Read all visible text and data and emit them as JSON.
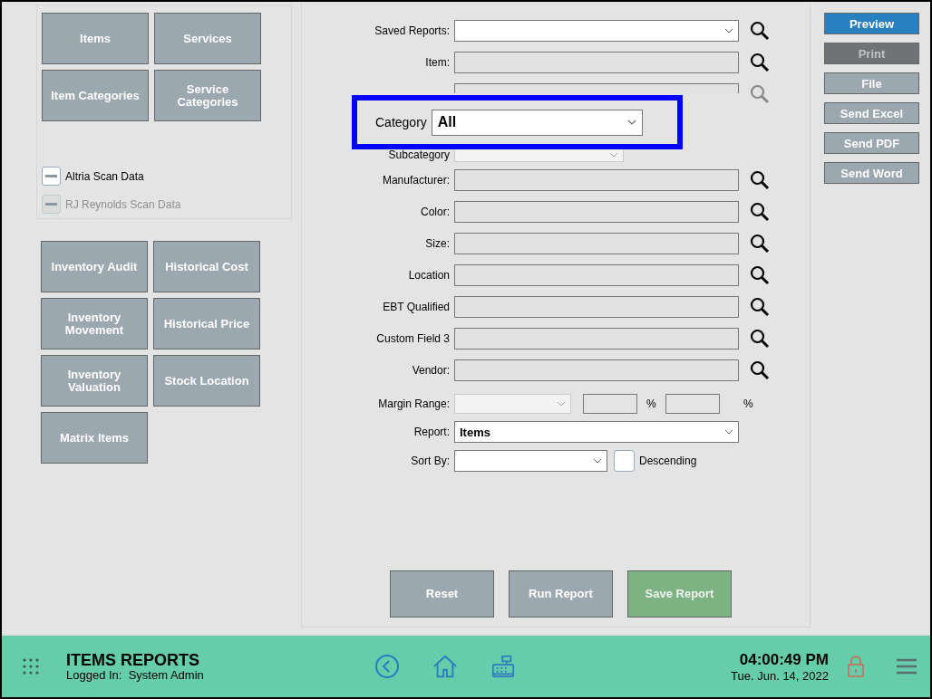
{
  "report_types": {
    "buttons": [
      {
        "label": "Items",
        "disabled": false
      },
      {
        "label": "Services",
        "disabled": false
      },
      {
        "label": "Item Categories",
        "disabled": false
      },
      {
        "label": "Service Categories",
        "disabled": false
      }
    ],
    "checkboxes": [
      {
        "label": "Altria Scan Data",
        "mixed": true,
        "disabled": false
      },
      {
        "label": "RJ Reynolds Scan Data",
        "mixed": true,
        "disabled": true
      }
    ]
  },
  "inventory_buttons": [
    {
      "label": "Inventory Audit"
    },
    {
      "label": "Historical Cost"
    },
    {
      "label": "Inventory Movement"
    },
    {
      "label": "Historical Price"
    },
    {
      "label": "Inventory Valuation"
    },
    {
      "label": "Stock Location"
    },
    {
      "label": "Matrix Items"
    }
  ],
  "form": {
    "rows": [
      {
        "kind": "dropdown",
        "label": "Saved Reports:",
        "value": "",
        "search": {
          "disabled": false
        }
      },
      {
        "kind": "lookup",
        "label": "Item:",
        "value": "",
        "search": {
          "disabled": false
        }
      },
      {
        "kind": "partial",
        "value": "",
        "search": {
          "disabled": true
        }
      },
      {
        "kind": "subcategory",
        "label": "Subcategory",
        "value": "",
        "disabled": true
      },
      {
        "kind": "lookup",
        "label": "Manufacturer:",
        "value": "",
        "search": {
          "disabled": false
        }
      },
      {
        "kind": "lookup",
        "label": "Color:",
        "value": "",
        "search": {
          "disabled": false
        }
      },
      {
        "kind": "lookup",
        "label": "Size:",
        "value": "",
        "search": {
          "disabled": false
        }
      },
      {
        "kind": "lookup",
        "label": "Location",
        "value": "",
        "search": {
          "disabled": false
        }
      },
      {
        "kind": "lookup",
        "label": "EBT Qualified",
        "value": "",
        "search": {
          "disabled": false
        }
      },
      {
        "kind": "lookup",
        "label": "Custom Field 3",
        "value": "",
        "search": {
          "disabled": false
        }
      },
      {
        "kind": "lookup",
        "label": "Vendor:",
        "value": "",
        "search": {
          "disabled": false
        }
      },
      {
        "kind": "margin",
        "label": "Margin Range:",
        "value": "",
        "disabled": true,
        "units": [
          "%",
          "%"
        ]
      },
      {
        "kind": "dropdown",
        "label": "Report:",
        "value": "Items"
      },
      {
        "kind": "sort",
        "label": "Sort By:",
        "value": "",
        "checkbox": {
          "label": "Descending",
          "checked": false
        }
      }
    ],
    "callout": {
      "label": "Category",
      "value": "All"
    },
    "actions": [
      {
        "label": "Reset",
        "kind": "plain",
        "disabled": false
      },
      {
        "label": "Run Report",
        "kind": "plain",
        "disabled": false
      },
      {
        "label": "Save Report",
        "kind": "save",
        "disabled": true
      }
    ]
  },
  "output_buttons": [
    {
      "label": "Preview",
      "kind": "primary",
      "disabled": false
    },
    {
      "label": "Print",
      "kind": "plain",
      "disabled": true
    },
    {
      "label": "File",
      "kind": "plain",
      "disabled": false
    },
    {
      "label": "Send Excel",
      "kind": "plain",
      "disabled": false
    },
    {
      "label": "Send PDF",
      "kind": "plain",
      "disabled": false
    },
    {
      "label": "Send Word",
      "kind": "plain",
      "disabled": false
    }
  ],
  "footer": {
    "title": "ITEMS REPORTS",
    "user_label": "Logged In:",
    "user": "System Admin",
    "time": "04:00:49 PM",
    "date": "Tue. Jun. 14, 2022"
  }
}
